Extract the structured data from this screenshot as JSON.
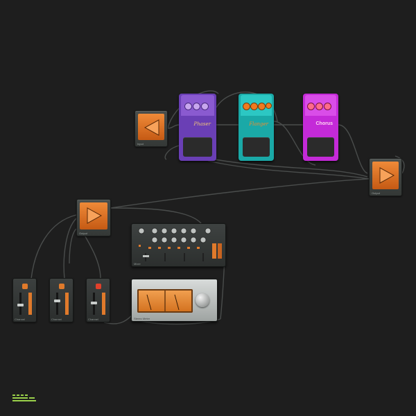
{
  "nodes": {
    "input": {
      "label": "Input"
    },
    "output_top": {
      "label": "Output"
    },
    "output_left": {
      "label": "Output"
    },
    "channels": [
      {
        "label": "Channel"
      },
      {
        "label": "Channel"
      },
      {
        "label": "Channel"
      }
    ],
    "mixer": {
      "label": "Mixer"
    },
    "meter": {
      "label": "Stereo Meter"
    }
  },
  "pedals": [
    {
      "name": "purple",
      "body": "#6a3fb5",
      "top": "#8a5ad0",
      "knob": "#c7a6ee",
      "brand": "Phaser"
    },
    {
      "name": "teal",
      "body": "#1aa9a7",
      "top": "#2cc7c3",
      "knob": "#f07a1e",
      "brand": "Flanger"
    },
    {
      "name": "magenta",
      "body": "#c42ad8",
      "top": "#d94de8",
      "knob": "#ff6b8a",
      "brand": "Chorus"
    }
  ],
  "colors": {
    "accent": "#e07a2b",
    "wire": "#4a4d4c",
    "logo": "#9ad14a"
  },
  "logo": {
    "icon": "app-logo-icon"
  }
}
